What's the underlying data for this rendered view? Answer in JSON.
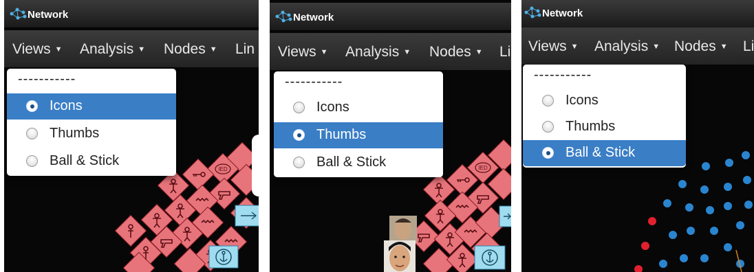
{
  "app": {
    "title": "Network"
  },
  "menu": {
    "views": "Views",
    "analysis": "Analysis",
    "nodes": "Nodes",
    "links_partial": "Lin"
  },
  "dropdown": {
    "separator": "-----------",
    "options": [
      "Icons",
      "Thumbs",
      "Ball & Stick"
    ]
  },
  "panels": [
    {
      "selected": "Icons"
    },
    {
      "selected": "Thumbs"
    },
    {
      "selected": "Ball & Stick"
    }
  ],
  "icon_labels": {
    "ied": "IED"
  },
  "colors": {
    "node_red": "#e8747b",
    "node_blue": "#2a85d0",
    "node_red_ball": "#e3202e",
    "highlight_blue": "#3a7ec6",
    "cyan_box": "#9fdcf0"
  },
  "icons": [
    "network-logo-icon",
    "caret-down-icon",
    "radio-icon",
    "person-icon",
    "gun-icon",
    "key-icon",
    "ied-icon",
    "wave-icon",
    "anchor-icon",
    "face-thumbnail-icon",
    "ball-node-icon"
  ]
}
